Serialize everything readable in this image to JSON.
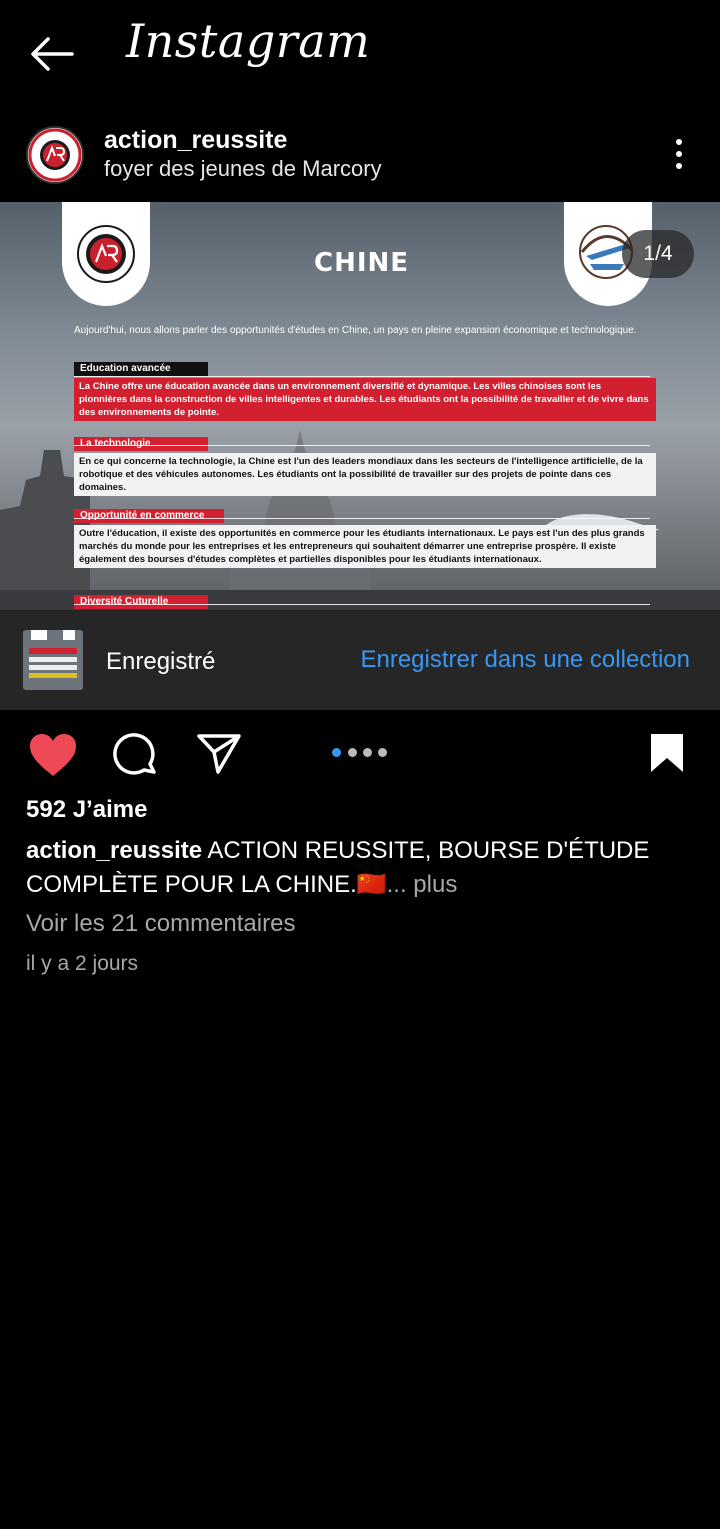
{
  "topbar": {
    "title": "Instagram"
  },
  "post": {
    "username": "action_reussite",
    "location": "foyer des jeunes de Marcory",
    "slide_counter": "1/4",
    "slide": {
      "title": "CHINE",
      "intro": "Aujourd'hui, nous allons parler des opportunités d'études en Chine, un pays en pleine expansion économique et technologique.",
      "sections": [
        {
          "label": "Education avancée",
          "text": "La Chine offre une éducation avancée dans un environnement diversifié et dynamique. Les villes chinoises sont les pionnières dans la construction de villes intelligentes et durables. Les étudiants ont la possibilité de travailler et de vivre dans des environnements de pointe."
        },
        {
          "label": "La technologie",
          "text": "En ce qui concerne la technologie, la Chine est l'un des leaders mondiaux dans les secteurs de l'intelligence artificielle, de la robotique et des véhicules autonomes. Les étudiants ont la possibilité de travailler sur des projets de pointe dans ces domaines."
        },
        {
          "label": "Opportunité en commerce",
          "text": "Outre l'éducation, il existe des opportunités en commerce pour les étudiants internationaux. Le pays est l'un des plus grands marchés du monde pour les entreprises et les entrepreneurs qui souhaitent démarrer une entreprise prospère. Il existe également des bourses d'études complètes et partielles disponibles pour les étudiants internationaux."
        },
        {
          "label": "Diversité Cuturelle",
          "text": ""
        }
      ]
    }
  },
  "saved_bar": {
    "saved_label": "Enregistré",
    "collection_link": "Enregistrer dans une collection"
  },
  "engagement": {
    "likes": "592 J’aime",
    "caption_user": "action_reussite",
    "caption_text": " ACTION REUSSITE, BOURSE D'ÉTUDE COMPLÈTE POUR LA CHINE.🇨🇳",
    "caption_more": "... plus",
    "comments_link": "Voir les 21 commentaires",
    "timestamp": "il y a 2 jours"
  },
  "colors": {
    "accent_blue": "#3897f0",
    "like_red": "#ed4956",
    "slide_red": "#d32030"
  }
}
